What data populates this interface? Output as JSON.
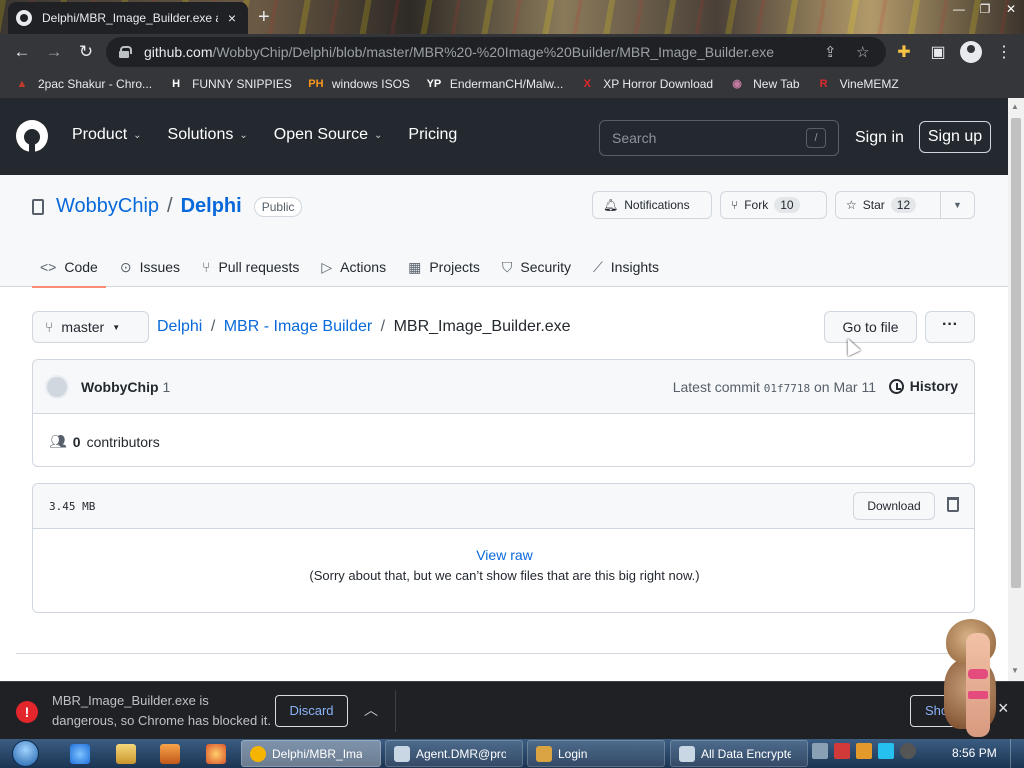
{
  "browser": {
    "tab_title": "Delphi/MBR_Image_Builder.exe a",
    "tab_close": "×",
    "new_tab": "+",
    "url_domain": "github.com",
    "url_path": "/WobbyChip/Delphi/blob/master/MBR%20-%20Image%20Builder/MBR_Image_Builder.exe",
    "icons": {
      "back": "arrow-left-icon",
      "forward": "arrow-right-icon",
      "reload": "reload-icon",
      "lock": "lock-icon",
      "share": "share-icon",
      "star": "star-icon",
      "extensions": "puzzle-icon",
      "sidebar": "sidebar-icon",
      "profile": "profile-icon",
      "menu": "kebab-menu-icon"
    }
  },
  "bookmarks": [
    {
      "label": "2pac Shakur - Chro...",
      "icon": "bookmark-favicon",
      "color": "#c0392b",
      "glyph": "▲"
    },
    {
      "label": "FUNNY SNIPPIES",
      "icon": "h-favicon",
      "color": "#ffffff",
      "glyph": "H"
    },
    {
      "label": "windows ISOS",
      "icon": "ph-favicon",
      "color": "#f7971d",
      "glyph": "PH"
    },
    {
      "label": "EndermanCH/Malw...",
      "icon": "yp-favicon",
      "color": "#ffffff",
      "glyph": "YP"
    },
    {
      "label": "XP Horror Download",
      "icon": "x-favicon",
      "color": "#e2262b",
      "glyph": "X"
    },
    {
      "label": "New Tab",
      "icon": "globe-favicon",
      "color": "#c27ba0",
      "glyph": "◉"
    },
    {
      "label": "VineMEMZ",
      "icon": "r-favicon",
      "color": "#e2262b",
      "glyph": "R"
    }
  ],
  "github": {
    "nav": [
      "Product",
      "Solutions",
      "Open Source",
      "Pricing"
    ],
    "search_placeholder": "Search",
    "search_shortcut": "/",
    "sign_in": "Sign in",
    "sign_up": "Sign up",
    "repo": {
      "owner": "WobbyChip",
      "separator": "/",
      "name": "Delphi",
      "visibility": "Public",
      "notifications": "Notifications",
      "fork_label": "Fork",
      "fork_count": "10",
      "star_label": "Star",
      "star_count": "12"
    },
    "tabs": [
      {
        "label": "Code",
        "icon": "code-icon",
        "glyph": "<>"
      },
      {
        "label": "Issues",
        "icon": "issue-icon",
        "glyph": "⊙"
      },
      {
        "label": "Pull requests",
        "icon": "pull-request-icon",
        "glyph": "⑂"
      },
      {
        "label": "Actions",
        "icon": "play-icon",
        "glyph": "▷"
      },
      {
        "label": "Projects",
        "icon": "table-icon",
        "glyph": "▦"
      },
      {
        "label": "Security",
        "icon": "shield-icon",
        "glyph": "⛉"
      },
      {
        "label": "Insights",
        "icon": "graph-icon",
        "glyph": "⟋"
      }
    ],
    "branch": "master",
    "breadcrumb": {
      "root": "Delphi",
      "folder": "MBR - Image Builder",
      "file": "MBR_Image_Builder.exe"
    },
    "go_to_file": "Go to file",
    "more": "···",
    "commit": {
      "author": "WobbyChip",
      "count": "1",
      "latest_prefix": "Latest commit",
      "sha": "01f7718",
      "date": "on Mar 11",
      "history": "History"
    },
    "contributors": {
      "count": "0",
      "label": "contributors"
    },
    "file": {
      "size": "3.45 MB",
      "download": "Download",
      "view_raw": "View raw",
      "too_big_message": "(Sorry about that, but we can’t show files that are this big right now.)"
    }
  },
  "download_bar": {
    "message": "MBR_Image_Builder.exe is dangerous, so Chrome has blocked it.",
    "discard": "Discard",
    "show_all": "Show all",
    "close": "×"
  },
  "taskbar": {
    "tasks": [
      {
        "label": "Delphi/MBR_Ima...",
        "icon": "chrome-icon",
        "color": "#f4b400"
      },
      {
        "label": "Agent.DMR@prot...",
        "icon": "window-icon",
        "color": "#c9d6e3"
      },
      {
        "label": "Login",
        "icon": "app-icon",
        "color": "#d9a441"
      },
      {
        "label": "All Data Encrypted",
        "icon": "window-icon",
        "color": "#c9d6e3"
      }
    ],
    "time": "8:56 PM"
  }
}
